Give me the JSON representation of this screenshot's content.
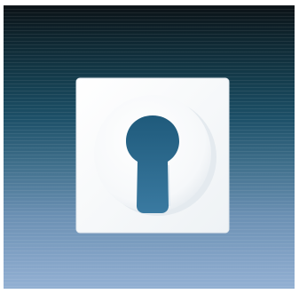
{
  "image": {
    "subject": "keyhole-cover-plate",
    "colors": {
      "background_top": "#0b1216",
      "background_mid": "#1d5068",
      "background_bottom": "#93b0d3",
      "plate": "#fafcfd",
      "keyhole": "#2f6a8d"
    }
  }
}
